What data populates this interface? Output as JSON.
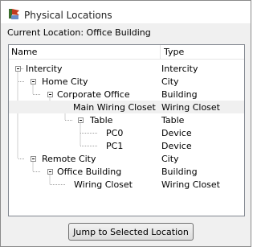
{
  "window": {
    "title": "Physical Locations",
    "current_location_text": "Current Location: Office Building"
  },
  "tree": {
    "columns": [
      "Name",
      "Type"
    ],
    "rows": [
      {
        "name": "Intercity",
        "type": "Intercity"
      },
      {
        "name": "Home City",
        "type": "City"
      },
      {
        "name": "Corporate Office",
        "type": "Building"
      },
      {
        "name": "Main Wiring Closet",
        "type": "Wiring Closet"
      },
      {
        "name": "Table",
        "type": "Table"
      },
      {
        "name": "PC0",
        "type": "Device"
      },
      {
        "name": "PC1",
        "type": "Device"
      },
      {
        "name": "Remote City",
        "type": "City"
      },
      {
        "name": "Office Building",
        "type": "Building"
      },
      {
        "name": "Wiring Closet",
        "type": "Wiring Closet"
      }
    ]
  },
  "button": {
    "jump_label": "Jump to Selected Location"
  },
  "icons": {
    "title": "network-location-icon"
  }
}
